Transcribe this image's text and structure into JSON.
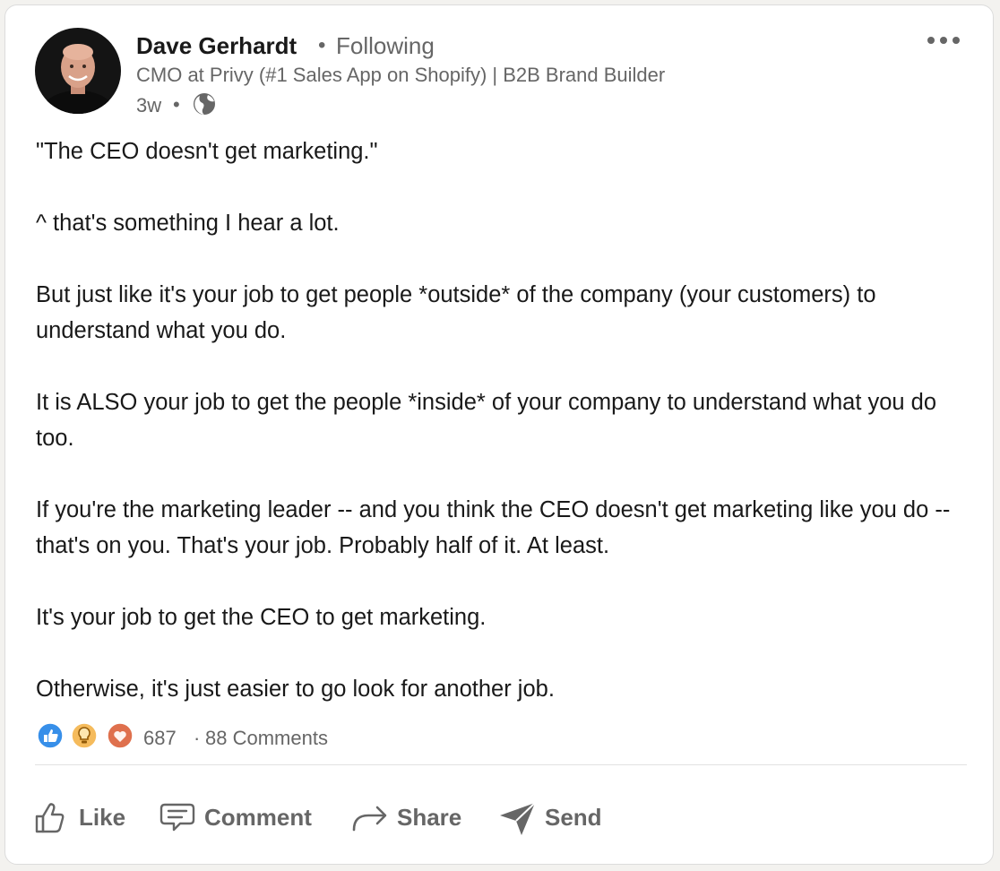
{
  "post": {
    "author": {
      "name": "Dave Gerhardt",
      "follow_status": "Following",
      "headline": "CMO at Privy (#1 Sales App on Shopify) | B2B Brand Builder",
      "age": "3w"
    },
    "paragraphs": [
      "\"The CEO doesn't get marketing.\"",
      "^ that's something I hear a lot.",
      "But just like it's your job to get people *outside* of the company (your customers) to understand what you do.",
      "It is ALSO your job to get the people *inside* of your company to understand what you do too.",
      "If you're the marketing leader -- and you think the CEO doesn't get marketing like you do -- that's on you. That's your job. Probably half of it. At least.",
      "It's your job to get the CEO to get marketing.",
      "Otherwise, it's just easier to go look for another job."
    ],
    "social": {
      "reaction_icons": [
        "like-icon",
        "insightful-icon",
        "love-icon"
      ],
      "reaction_count": "687",
      "comments": "88 Comments"
    },
    "actions": {
      "like": "Like",
      "comment": "Comment",
      "share": "Share",
      "send": "Send"
    }
  },
  "colors": {
    "text_primary": "#191919",
    "text_secondary": "#666666",
    "like_blue": "#378fe9",
    "insight_yellow": "#f5bb5c",
    "love_red": "#df704d"
  }
}
